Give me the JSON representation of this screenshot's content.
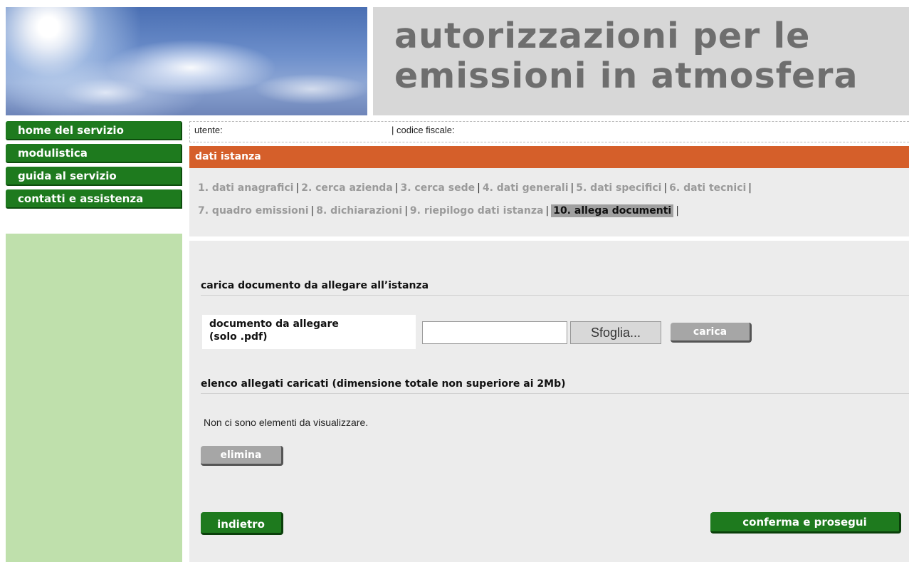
{
  "header": {
    "title_line1": "autorizzazioni per le",
    "title_line2": "emissioni in atmosfera"
  },
  "sidebar": {
    "items": [
      {
        "label": "home del servizio"
      },
      {
        "label": "modulistica"
      },
      {
        "label": "guida al servizio"
      },
      {
        "label": "contatti e assistenza"
      }
    ]
  },
  "userbar": {
    "user_label": "utente:",
    "cf_label": "| codice fiscale:"
  },
  "section": {
    "title": "dati istanza"
  },
  "steps": {
    "row1": [
      "1. dati anagrafici",
      "2. cerca azienda",
      "3. cerca sede",
      "4. dati generali",
      "5. dati specifici",
      "6. dati tecnici"
    ],
    "row2": [
      "7. quadro emissioni",
      "8. dichiarazioni",
      "9. riepilogo dati istanza",
      "10. allega documenti"
    ],
    "active": "10. allega documenti"
  },
  "upload": {
    "heading": "carica documento da allegare all’istanza",
    "label_line1": "documento da allegare",
    "label_line2": "(solo .pdf)",
    "file_value": "",
    "browse_label": "Sfoglia...",
    "upload_label": "carica"
  },
  "attachments": {
    "heading": "elenco allegati caricati (dimensione totale non superiore ai 2Mb)",
    "empty_message": "Non ci sono elementi da visualizzare.",
    "delete_label": "elimina"
  },
  "footer": {
    "back_label": "indietro",
    "confirm_label": "conferma e prosegui"
  },
  "colors": {
    "nav_green": "#1e7a1e",
    "section_orange": "#d55f2a",
    "sidebar_panel": "#bfe0ac",
    "panel_grey": "#ececec",
    "title_grey": "#6e6e6e"
  }
}
